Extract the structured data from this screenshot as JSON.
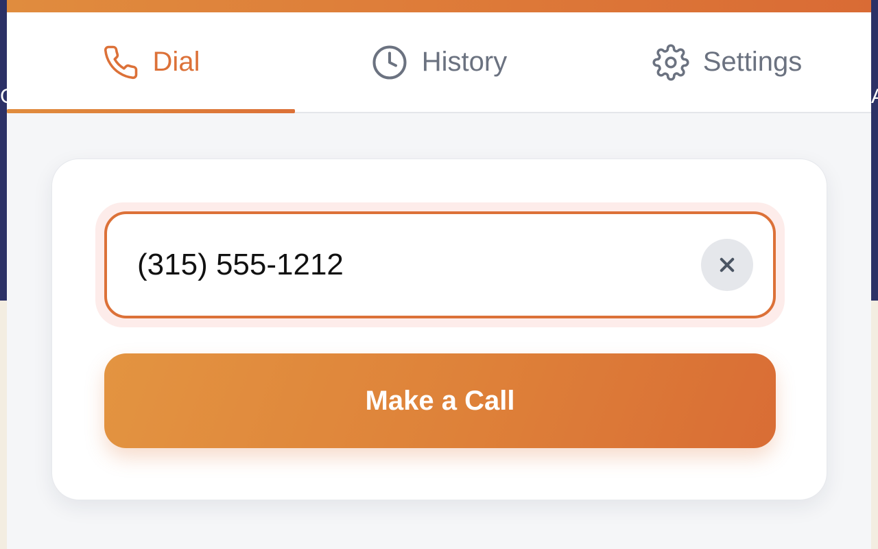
{
  "background": {
    "left_glyph": "G",
    "right_glyph": "A"
  },
  "colors": {
    "accent": "#dc7138",
    "accent_light": "#e39441",
    "inactive_tab": "#6b7280",
    "clear_button_bg": "#e5e7eb"
  },
  "tabs": [
    {
      "label": "Dial",
      "icon": "phone-icon",
      "active": true
    },
    {
      "label": "History",
      "icon": "clock-icon",
      "active": false
    },
    {
      "label": "Settings",
      "icon": "gear-icon",
      "active": false
    }
  ],
  "dial": {
    "phone_value": "(315) 555-1212",
    "clear_icon": "close-icon",
    "call_button_label": "Make a Call"
  }
}
